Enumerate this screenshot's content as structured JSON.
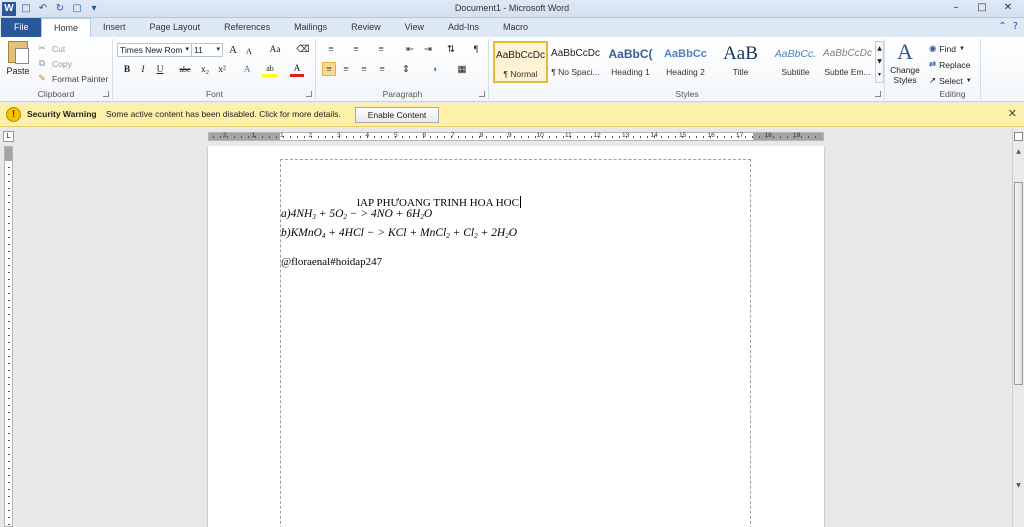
{
  "window": {
    "title": "Document1 - Microsoft Word",
    "controls": [
      "–",
      "□",
      "✕"
    ]
  },
  "quick_access": {
    "app_icon": "W",
    "icons": [
      "save-icon",
      "undo-icon",
      "redo-icon",
      "new-document-icon",
      "customize-icon"
    ]
  },
  "tabs": [
    {
      "label": "File"
    },
    {
      "label": "Home"
    },
    {
      "label": "Insert"
    },
    {
      "label": "Page Layout"
    },
    {
      "label": "References"
    },
    {
      "label": "Mailings"
    },
    {
      "label": "Review"
    },
    {
      "label": "View"
    },
    {
      "label": "Add-Ins"
    },
    {
      "label": "Macro"
    }
  ],
  "ribbon": {
    "clipboard": {
      "label": "Clipboard",
      "paste": "Paste",
      "cut": "Cut",
      "copy": "Copy",
      "format_painter": "Format Painter"
    },
    "font": {
      "label": "Font",
      "font_name": "Times New Rom",
      "font_size": "11",
      "grow": "A",
      "shrink": "A",
      "change_case": "Aa",
      "bold": "B",
      "italic": "I",
      "underline": "U",
      "strikethrough": "abc",
      "subscript": "x₂",
      "superscript": "x²",
      "text_effects": "A",
      "highlight": "ab",
      "font_color": "A"
    },
    "paragraph": {
      "label": "Paragraph",
      "show_marks": "¶"
    },
    "styles": {
      "label": "Styles",
      "items": [
        {
          "sample": "AaBbCcDc",
          "name": "¶ Normal",
          "color": "#222222"
        },
        {
          "sample": "AaBbCcDc",
          "name": "¶ No Spaci...",
          "color": "#222222"
        },
        {
          "sample": "AaBbC(",
          "name": "Heading 1",
          "color": "#365f91"
        },
        {
          "sample": "AaBbCc",
          "name": "Heading 2",
          "color": "#4f81bd"
        },
        {
          "sample": "AaB",
          "name": "Title",
          "color": "#17365d"
        },
        {
          "sample": "AaBbCc.",
          "name": "Subtitle",
          "color": "#4f81bd"
        },
        {
          "sample": "AaBbCcDc",
          "name": "Subtle Em...",
          "color": "#7f7f7f"
        }
      ],
      "change_styles_line1": "Change",
      "change_styles_line2": "Styles"
    },
    "editing": {
      "label": "Editing",
      "find": "Find",
      "replace": "Replace",
      "select": "Select"
    }
  },
  "security_bar": {
    "title": "Security Warning",
    "message": "Some active content has been disabled. Click for more details.",
    "button": "Enable Content"
  },
  "ruler": {
    "numbers": [
      "2",
      "1",
      "1",
      "2",
      "3",
      "4",
      "5",
      "6",
      "7",
      "8",
      "9",
      "10",
      "11",
      "12",
      "13",
      "14",
      "15",
      "16",
      "17",
      "18",
      "19"
    ]
  },
  "document": {
    "heading": "lAP PHƯOANG TRINH HOA HOC",
    "eq_a": {
      "prefix": "a)4NH",
      "sub1": "3",
      "mid1": " + 5O",
      "sub2": "2",
      "mid2": " − > 4NO + 6H",
      "sub3": "2",
      "suffix": "O"
    },
    "eq_b": {
      "prefix": "b)KMnO",
      "sub1": "4",
      "mid1": " + 4HCl − > KCl + MnCl",
      "sub2": "2",
      "mid2": " + Cl",
      "sub3": "2",
      "mid3": " + 2H",
      "sub4": "2",
      "suffix": "O"
    },
    "signature": "@floraenal#hoidap247"
  },
  "colors": {
    "accent": "#2b579a",
    "security_bar": "#fdf0a8",
    "selected_style": "#e3b93a"
  }
}
